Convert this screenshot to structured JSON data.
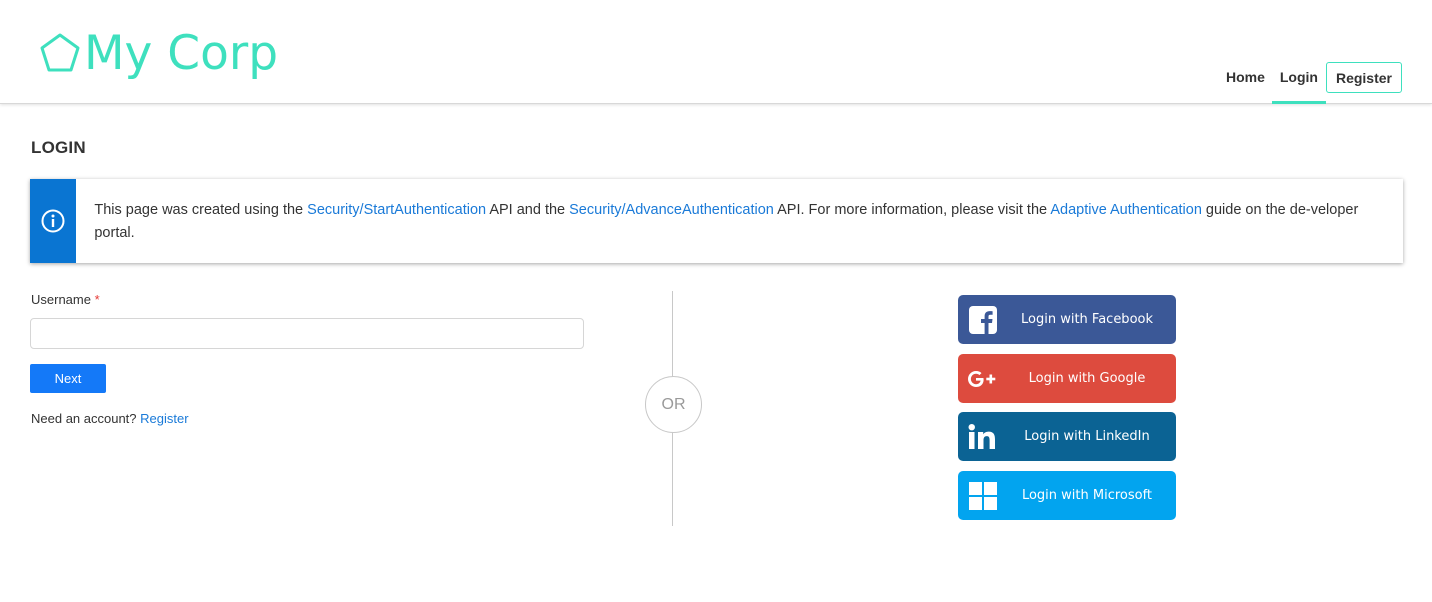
{
  "brand": {
    "name": "My Corp",
    "accent_color": "#3ee0be"
  },
  "nav": {
    "home_label": "Home",
    "login_label": "Login",
    "register_label": "Register",
    "active": "Login"
  },
  "page": {
    "title": "LOGIN"
  },
  "banner": {
    "icon": "info-icon",
    "text_1": "This page was created using the ",
    "link_1": "Security/StartAuthentication",
    "text_2": " API and the ",
    "link_2": "Security/AdvanceAuthentication",
    "text_3": " API. For more information, please visit the ",
    "link_3": "Adaptive Authentication",
    "text_4": " guide on the de-veloper portal.",
    "accent_color": "#0a75d2"
  },
  "form": {
    "username_label": "Username",
    "required_mark": "*",
    "username_value": "",
    "next_label": "Next",
    "need_account_text": "Need an account? ",
    "register_link": "Register"
  },
  "divider": {
    "or_label": "OR"
  },
  "social": [
    {
      "label": "Login with Facebook",
      "icon": "facebook-icon",
      "color": "#3b5897"
    },
    {
      "label": "Login with Google",
      "icon": "google-plus-icon",
      "color": "#dd4b3e"
    },
    {
      "label": "Login with LinkedIn",
      "icon": "linkedin-icon",
      "color": "#0b6394"
    },
    {
      "label": "Login with Microsoft",
      "icon": "microsoft-icon",
      "color": "#02a4ef"
    }
  ]
}
